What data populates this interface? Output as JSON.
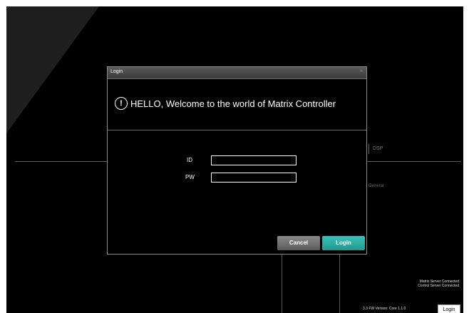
{
  "background": {
    "dsp_tab": "DSP",
    "general_label": "General",
    "status_lines": [
      "Matrix Server Connected",
      "Control Server Connected"
    ],
    "fw_version": "3.3 FW Version: Core 1.1.0",
    "login_button": "Login"
  },
  "dialog": {
    "title": "Login",
    "close_glyph": "×",
    "icon": "info-circle-icon",
    "welcome": "HELLO, Welcome to the world of Matrix Controller",
    "id_label": "ID",
    "id_value": "",
    "pw_label": "PW",
    "pw_value": "",
    "cancel_label": "Cancel",
    "login_label": "Login"
  },
  "colors": {
    "background": "#000000",
    "login_accent": "#2bb0a7",
    "cancel_gray": "#707070"
  }
}
